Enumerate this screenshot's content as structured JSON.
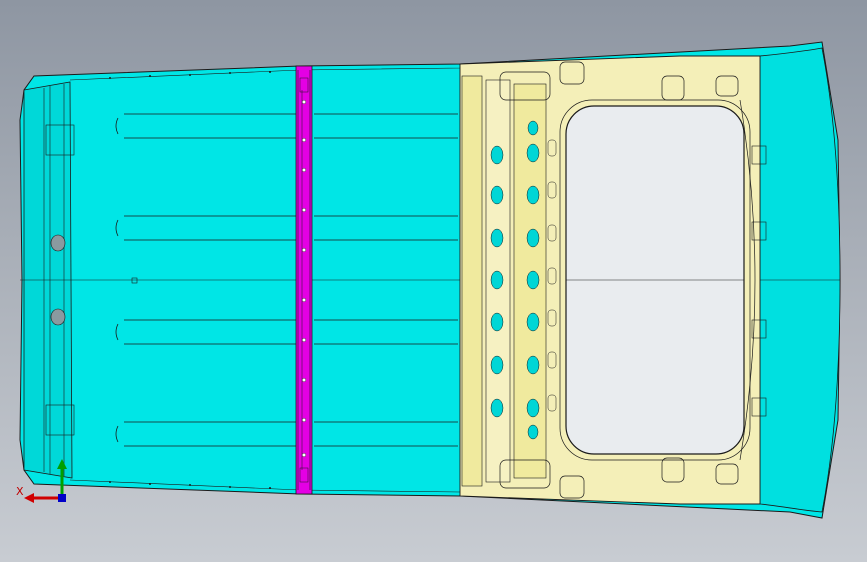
{
  "view": {
    "background_top": "#8e96a2",
    "background_bottom": "#c8ccd2"
  },
  "model": {
    "roof_panel_color": "#00e8e8",
    "bow_color": "#e400e4",
    "frame_color": "#f4efb8",
    "outline_color": "#1a1a1a",
    "opening_color": "#e9ecef"
  },
  "triad": {
    "x_axis_label": "X",
    "x_color": "#d00000",
    "y_color": "#00a000",
    "z_color": "#0000c8"
  }
}
